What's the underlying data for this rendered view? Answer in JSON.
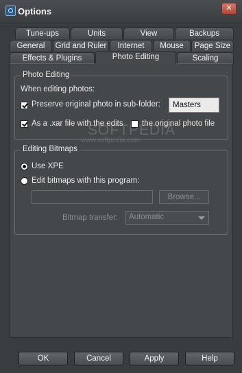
{
  "window": {
    "title": "Options",
    "close_label": "✕"
  },
  "tabs": {
    "row1": [
      "Tune-ups",
      "Units",
      "View",
      "Backups"
    ],
    "row2": [
      "General",
      "Grid and Ruler",
      "Internet",
      "Mouse",
      "Page Size"
    ],
    "row3": [
      "Effects & Plugins",
      "Photo Editing",
      "Scaling"
    ],
    "active": "Photo Editing"
  },
  "photo_editing": {
    "group_label": "Photo Editing",
    "intro": "When editing photos:",
    "preserve_label": "Preserve original photo in sub-folder:",
    "preserve_checked": true,
    "subfolder_value": "Masters",
    "xar_label": "As a .xar file with the edits",
    "xar_checked": true,
    "original_label": "the original photo file",
    "original_checked": false
  },
  "editing_bitmaps": {
    "group_label": "Editing Bitmaps",
    "use_xpe_label": "Use XPE",
    "use_xpe_selected": true,
    "edit_with_program_label": "Edit bitmaps with this program:",
    "edit_with_program_selected": false,
    "program_path_value": "",
    "browse_label": "Browse...",
    "bitmap_transfer_label": "Bitmap transfer:",
    "bitmap_transfer_value": "Automatic"
  },
  "watermark": {
    "main": "SOFTPEDIA",
    "url": "www.softpedia.com"
  },
  "footer": {
    "ok": "OK",
    "cancel": "Cancel",
    "apply": "Apply",
    "help": "Help"
  }
}
